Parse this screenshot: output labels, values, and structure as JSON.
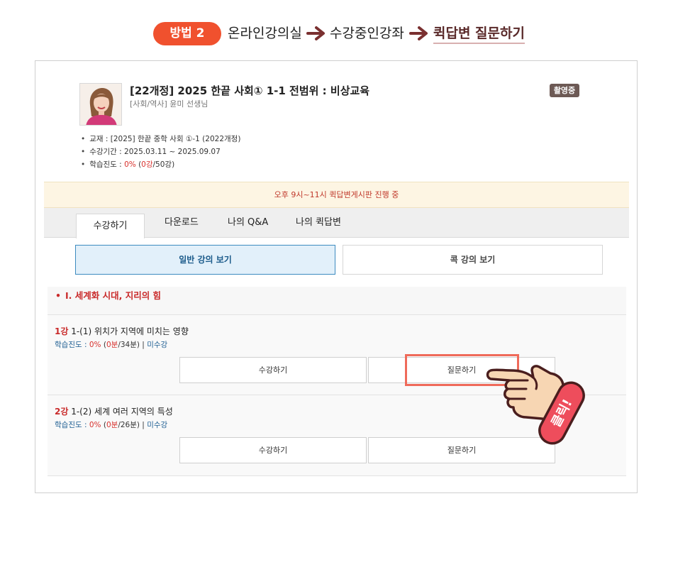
{
  "header": {
    "method_label": "방법 2",
    "step1": "온라인강의실",
    "step2": "수강중인강좌",
    "step3": "퀵답변 질문하기"
  },
  "course": {
    "title": "[22개정] 2025 한끝 사회① 1-1 전범위 : 비상교육",
    "subtitle": "[사회/역사] 윤미 선생님",
    "badge": "촬영중",
    "textbook_label": "교재 : [2025] 한끝 중학 사회 ①-1 (2022개정)",
    "period_label": "수강기간 : 2025.03.11 ~ 2025.09.07",
    "progress_prefix": "학습진도 : ",
    "progress_pct": "0%",
    "progress_open": " (",
    "progress_done": "0강",
    "progress_total": "/50강)"
  },
  "notice": "오후 9시~11시 퀵답변게시판 진행 중",
  "tabs": [
    "수강하기",
    "다운로드",
    "나의 Q&A",
    "나의 퀵답변"
  ],
  "view_buttons": {
    "general": "일반 강의 보기",
    "short": "콕 강의 보기"
  },
  "section_title": "Ⅰ. 세계화 시대, 지리의 힘",
  "lessons": [
    {
      "num": "1강",
      "title": " 1-(1) 위치가 지역에 미치는 영향",
      "progress_label": "학습진도 : ",
      "pct": "0%",
      "open": " (",
      "done": "0분",
      "total": "/34분)",
      "sep": " | ",
      "status": "미수강",
      "watch_btn": "수강하기",
      "ask_btn": "질문하기"
    },
    {
      "num": "2강",
      "title": " 1-(2) 세계 여러 지역의 특성",
      "progress_label": "학습진도 : ",
      "pct": "0%",
      "open": " (",
      "done": "0분",
      "total": "/26분)",
      "sep": " | ",
      "status": "미수강",
      "watch_btn": "수강하기",
      "ask_btn": "질문하기"
    }
  ],
  "click_tag": "클릭!",
  "colors": {
    "accent": "#f0512e",
    "arrow": "#7a3030",
    "selected_blue": "#3d8bbf",
    "highlight": "#ef6a5a"
  }
}
